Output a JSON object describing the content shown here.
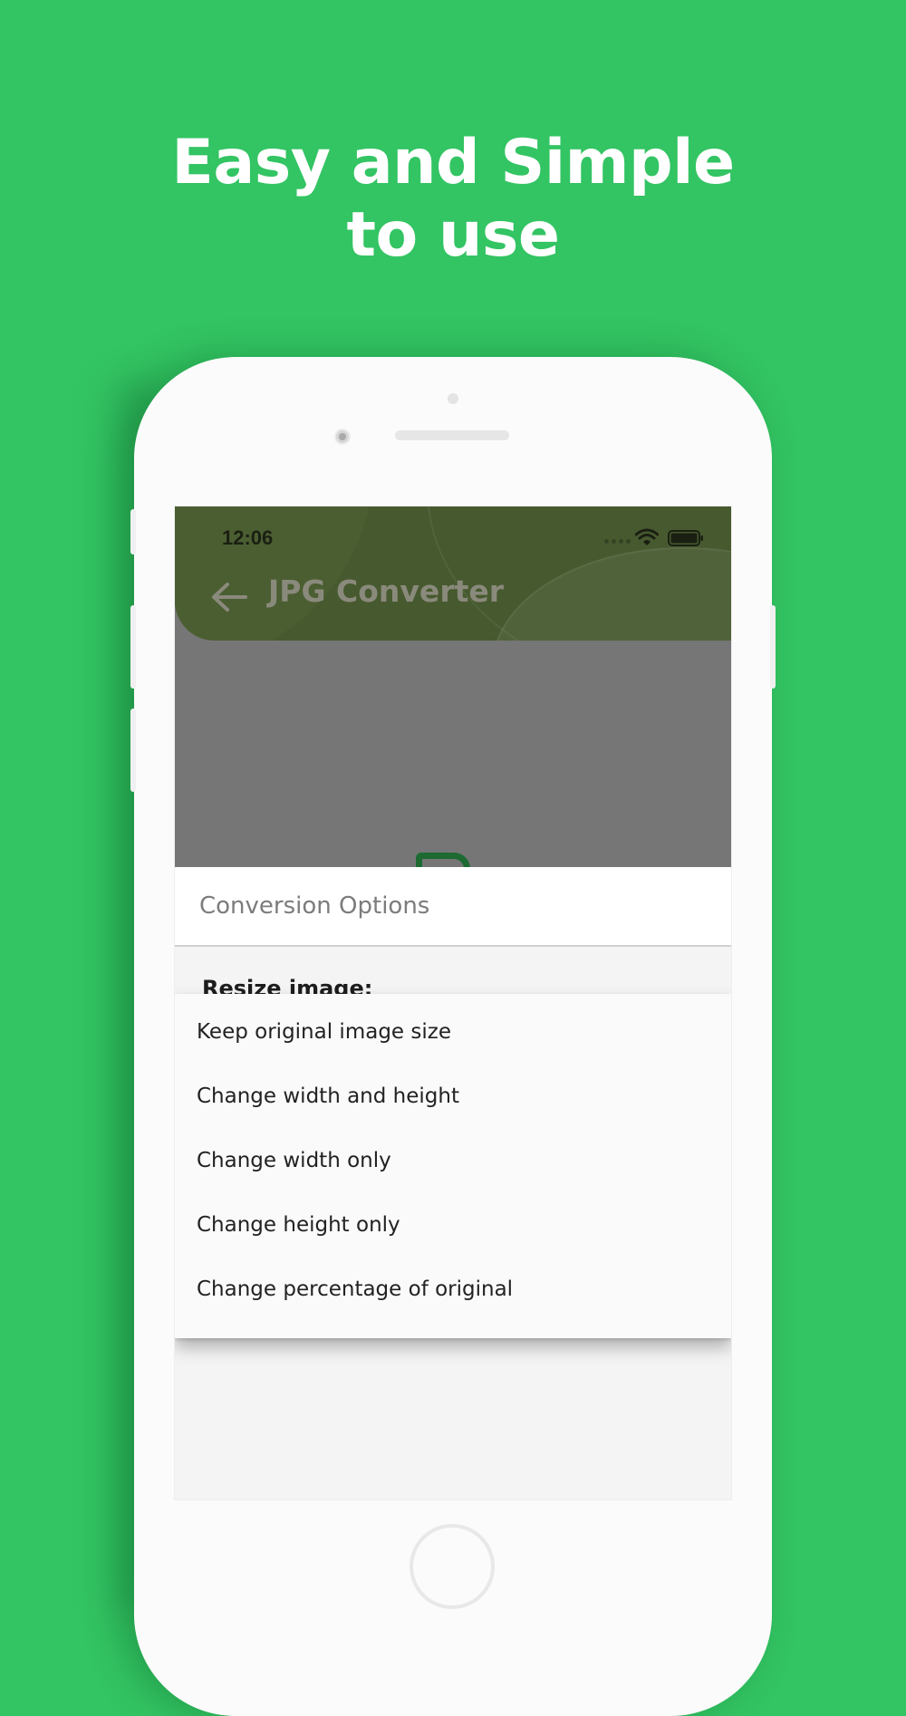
{
  "headline": {
    "line1": "Easy and Simple",
    "line2": "to use"
  },
  "status_bar": {
    "time": "12:06"
  },
  "app_bar": {
    "title": "JPG Converter"
  },
  "options": {
    "title": "Conversion Options",
    "resize_label": "Resize image:",
    "dropdown_items": [
      "Keep original image size",
      "Change width and height",
      "Change width only",
      "Change height only",
      "Change percentage of original"
    ]
  },
  "colors": {
    "background": "#33c463",
    "app_bar": "#475a2f",
    "overlay": "#767676",
    "dropdown": "#fafafa"
  },
  "icons": [
    "back-arrow-icon",
    "wifi-icon",
    "battery-icon",
    "signal-icon",
    "file-icon"
  ]
}
